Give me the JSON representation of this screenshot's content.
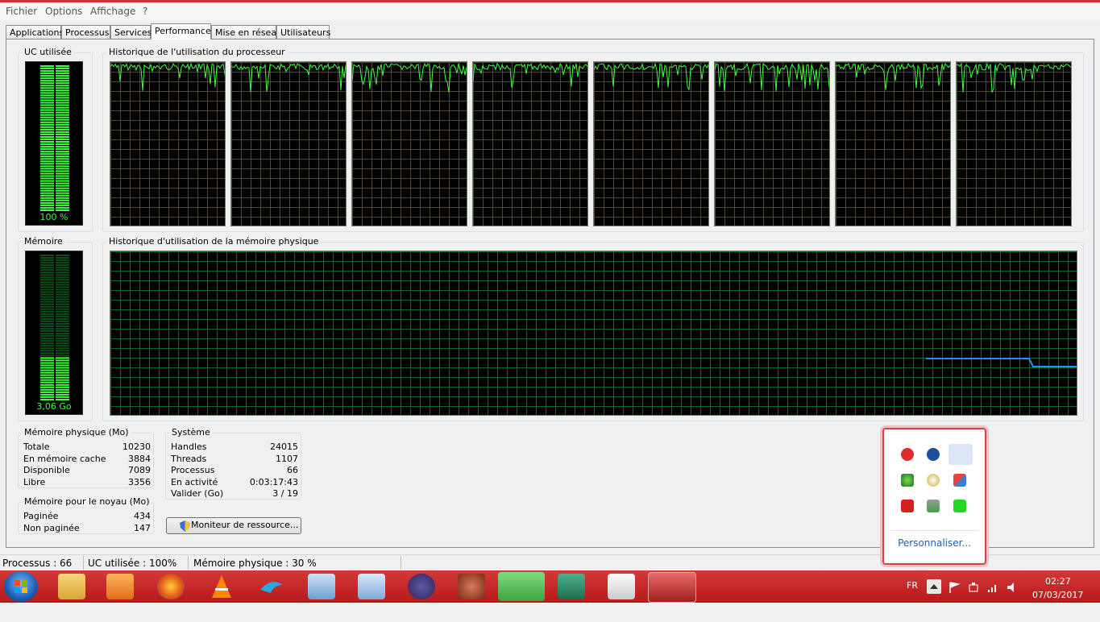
{
  "menu": {
    "items": [
      "Fichier",
      "Options",
      "Affichage",
      "?"
    ]
  },
  "tabs": [
    {
      "label": "Applications"
    },
    {
      "label": "Processus"
    },
    {
      "label": "Services"
    },
    {
      "label": "Performance"
    },
    {
      "label": "Mise en réseau"
    },
    {
      "label": "Utilisateurs"
    }
  ],
  "cpu_meter": {
    "label": "UC utilisée",
    "value_text": "100 %",
    "level": 1.0
  },
  "cpu_history": {
    "label": "Historique de l'utilisation du processeur"
  },
  "mem_meter": {
    "label": "Mémoire",
    "value_text": "3,06 Go",
    "level": 0.3
  },
  "mem_history": {
    "label": "Historique d'utilisation de la mémoire physique"
  },
  "physical_memory": {
    "title": "Mémoire physique (Mo)",
    "rows": [
      {
        "label": "Totale",
        "value": "10230"
      },
      {
        "label": "En mémoire cache",
        "value": "3884"
      },
      {
        "label": "Disponible",
        "value": "7089"
      },
      {
        "label": "Libre",
        "value": "3356"
      }
    ]
  },
  "kernel_memory": {
    "title": "Mémoire pour le noyau (Mo)",
    "rows": [
      {
        "label": "Paginée",
        "value": "434"
      },
      {
        "label": "Non paginée",
        "value": "147"
      }
    ]
  },
  "system": {
    "title": "Système",
    "rows": [
      {
        "label": "Handles",
        "value": "24015"
      },
      {
        "label": "Threads",
        "value": "1107"
      },
      {
        "label": "Processus",
        "value": "66"
      },
      {
        "label": "En activité",
        "value": "0:03:17:43"
      },
      {
        "label": "Valider (Go)",
        "value": "3 / 19"
      }
    ]
  },
  "resource_button": {
    "label": "Moniteur de ressource..."
  },
  "statusbar": {
    "processes": "Processus : 66",
    "cpu": "UC utilisée : 100%",
    "memory": "Mémoire physique : 30 %"
  },
  "tray_popup": {
    "customize": "Personnaliser..."
  },
  "tray": {
    "lang": "FR",
    "time": "02:27",
    "date": "07/03/2017"
  },
  "colors": {
    "graph_green": "#3fff3f",
    "mem_line": "#1e90ff",
    "taskbar": "#c62828"
  }
}
